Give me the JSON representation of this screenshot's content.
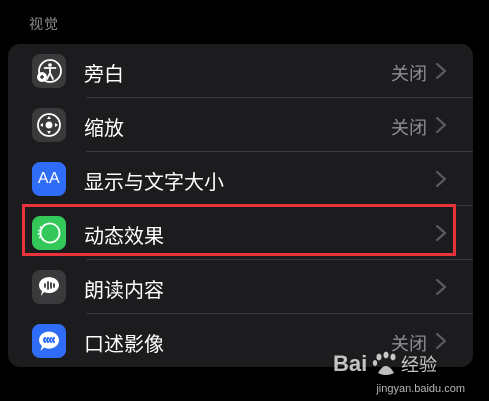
{
  "section_title": "视觉",
  "rows": [
    {
      "label": "旁白",
      "value": "关闭",
      "icon": "voiceover-icon",
      "icon_bg": "#3a3a3c"
    },
    {
      "label": "缩放",
      "value": "关闭",
      "icon": "zoom-icon",
      "icon_bg": "#3a3a3c"
    },
    {
      "label": "显示与文字大小",
      "value": "",
      "icon": "text-size-icon",
      "icon_bg": "#2f6df6",
      "icon_text": "AA"
    },
    {
      "label": "动态效果",
      "value": "",
      "icon": "motion-icon",
      "icon_bg": "#34c759"
    },
    {
      "label": "朗读内容",
      "value": "",
      "icon": "spoken-content-icon",
      "icon_bg": "#3a3a3c"
    },
    {
      "label": "口述影像",
      "value": "关闭",
      "icon": "audio-description-icon",
      "icon_bg": "#2f6df6"
    }
  ],
  "colors": {
    "highlight": "#e8333b",
    "card_bg": "#1c1c1e",
    "secondary_text": "#8e8e93"
  },
  "watermark": {
    "url": "jingyan.baidu.com"
  }
}
